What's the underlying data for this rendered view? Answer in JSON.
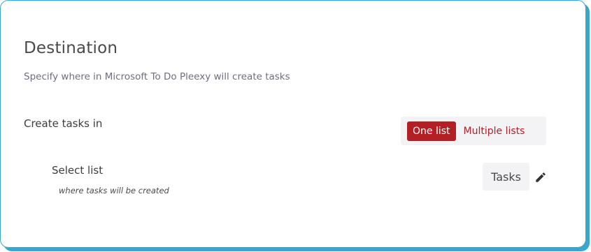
{
  "section": {
    "title": "Destination",
    "subtitle": "Specify where in Microsoft To Do Pleexy will create tasks"
  },
  "create_tasks": {
    "label": "Create tasks in",
    "options": [
      {
        "label": "One list",
        "selected": true
      },
      {
        "label": "Multiple lists",
        "selected": false
      }
    ]
  },
  "select_list": {
    "label": "Select list",
    "hint": "where tasks will be created",
    "value": "Tasks",
    "edit_icon": "pencil-icon"
  },
  "colors": {
    "accent": "#b22026",
    "card_border": "#3aa6c9",
    "segment_bg": "#f3f3f5"
  }
}
